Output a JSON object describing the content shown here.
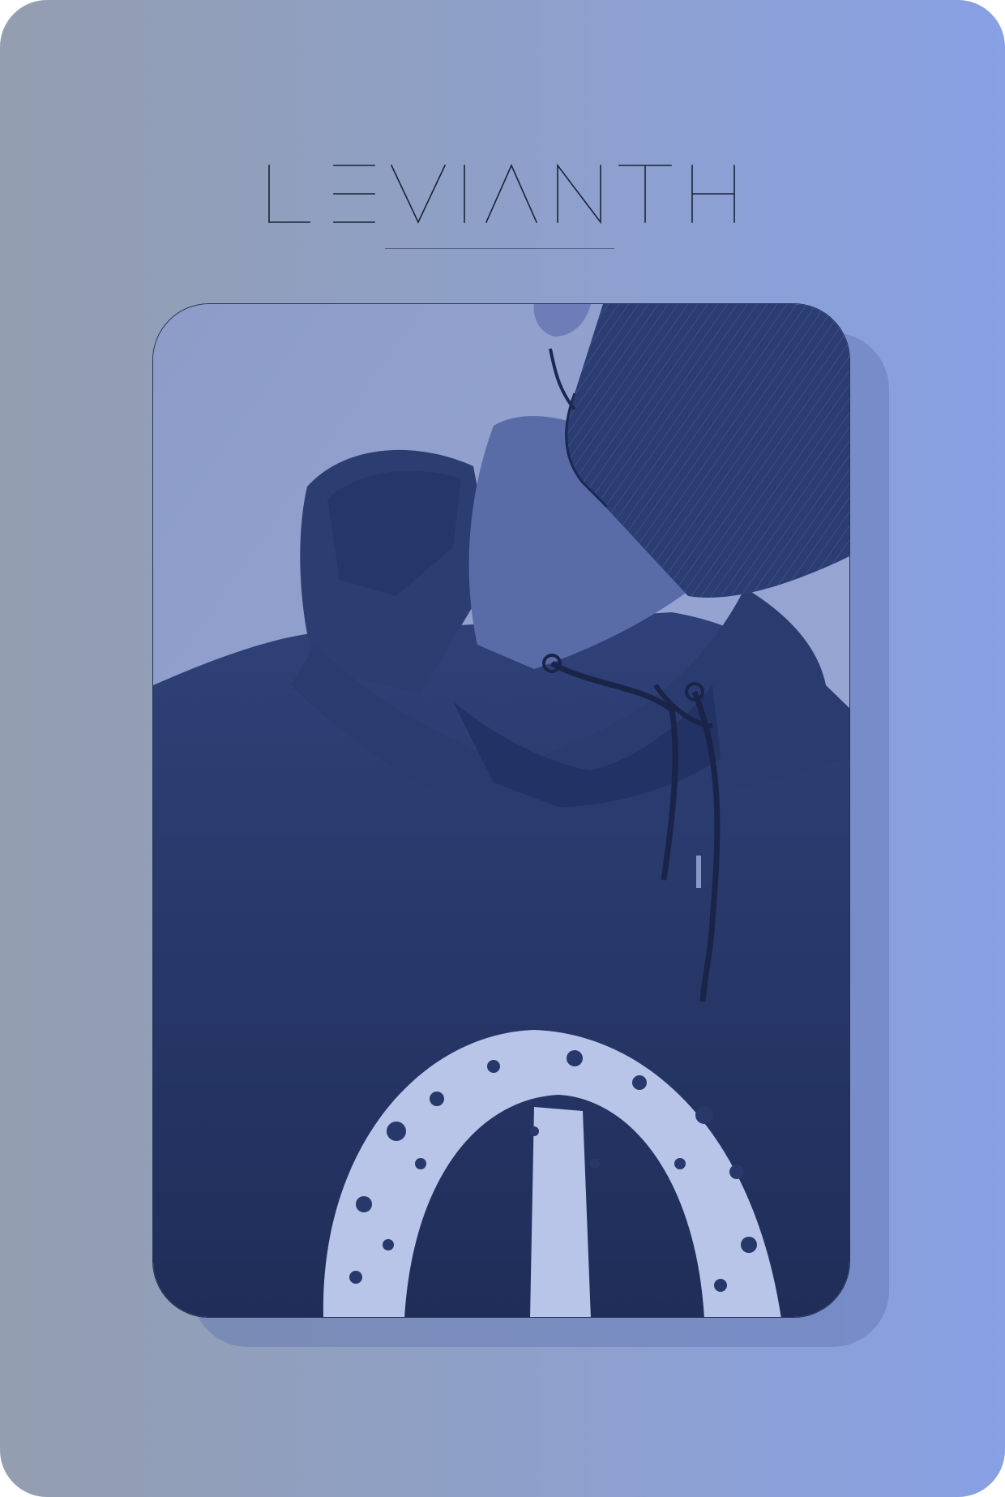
{
  "brand": {
    "name": "LEVIANTH"
  },
  "colors": {
    "background_left": "#939eb0",
    "background_right": "#88a0e4",
    "logo_stroke": "#1b2333",
    "photo_tint": "#2e4a86",
    "hoodie": "#27386a",
    "print": "#b8c4e8"
  },
  "photo": {
    "subject": "person-in-hoodie-with-mask-icon"
  }
}
